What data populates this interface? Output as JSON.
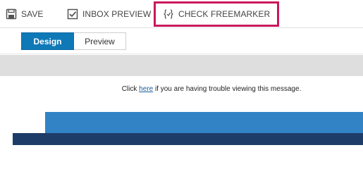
{
  "toolbar": {
    "save_label": "SAVE",
    "inbox_preview_label": "INBOX PREVIEW",
    "check_freemarker_label": "CHECK FREEMARKER",
    "highlight_color": "#c8195b"
  },
  "tabs": {
    "design_label": "Design",
    "preview_label": "Preview",
    "active": "Design",
    "active_color": "#0f79b8"
  },
  "email": {
    "trouble_prefix": "Click ",
    "trouble_link": "here",
    "trouble_suffix": " if you are having trouble viewing this message.",
    "banner_color": "#3283c6",
    "band_color": "#1d3d68"
  },
  "icons": {
    "save": "save-icon",
    "inbox_preview": "checkbox-icon",
    "check_freemarker": "code-braces-icon"
  }
}
